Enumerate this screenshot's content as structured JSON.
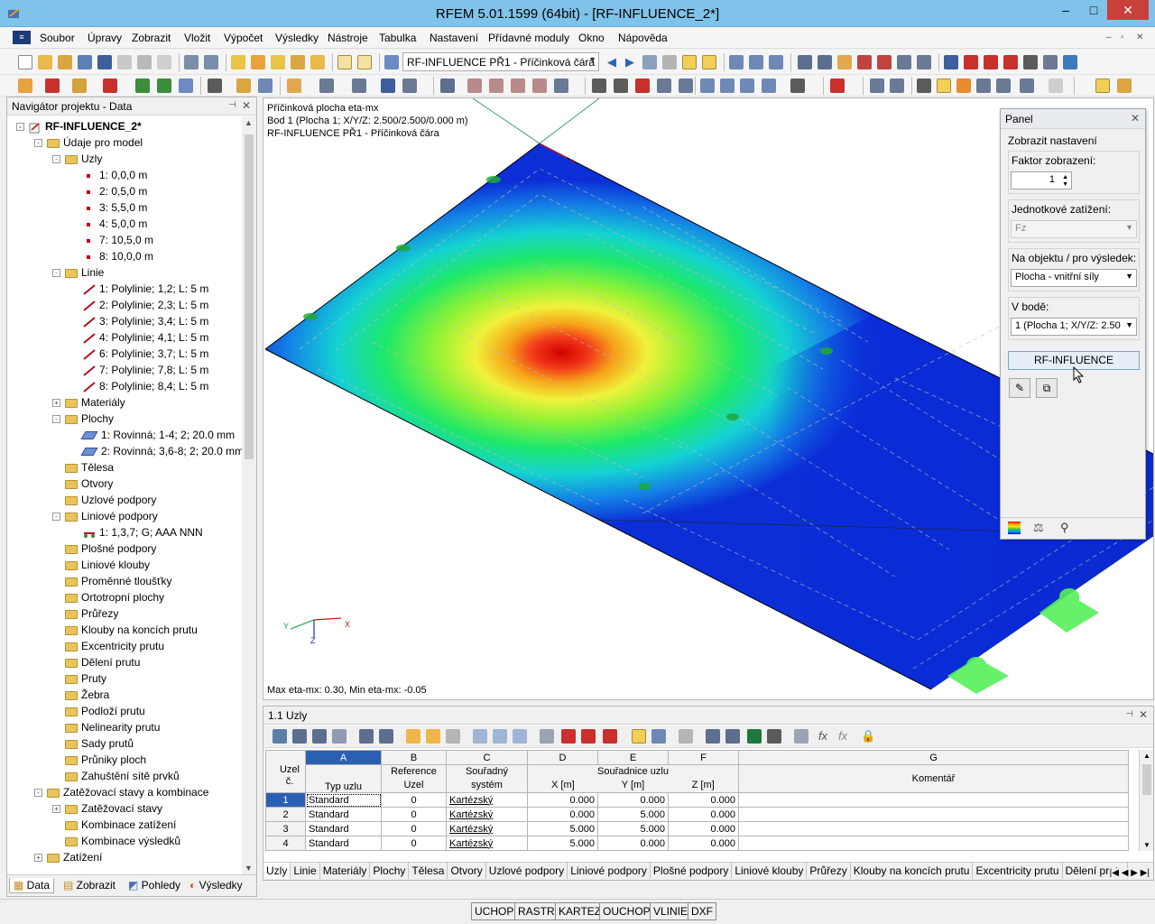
{
  "window": {
    "title": "RFEM 5.01.1599 (64bit) - [RF-INFLUENCE_2*]",
    "min": "–",
    "max": "□",
    "close": "✕"
  },
  "menu": [
    "Soubor",
    "Úpravy",
    "Zobrazit",
    "Vložit",
    "Výpočet",
    "Výsledky",
    "Nástroje",
    "Tabulka",
    "Nastavení",
    "Přídavné moduly",
    "Okno",
    "Nápověda"
  ],
  "toolbar": {
    "case_combo": "RF-INFLUENCE PŘ1 - Příčinková čára"
  },
  "navigator": {
    "title": "Navigátor projektu - Data",
    "root": "RF-INFLUENCE_2*",
    "items": [
      {
        "label": "Údaje pro model",
        "level": 1,
        "kind": "folder",
        "exp": "-"
      },
      {
        "label": "Uzly",
        "level": 2,
        "kind": "folder",
        "exp": "-"
      },
      {
        "label": "1: 0,0,0 m",
        "level": 3,
        "kind": "node"
      },
      {
        "label": "2: 0,5,0 m",
        "level": 3,
        "kind": "node"
      },
      {
        "label": "3: 5,5,0 m",
        "level": 3,
        "kind": "node"
      },
      {
        "label": "4: 5,0,0 m",
        "level": 3,
        "kind": "node"
      },
      {
        "label": "7: 10,5,0 m",
        "level": 3,
        "kind": "node"
      },
      {
        "label": "8: 10,0,0 m",
        "level": 3,
        "kind": "node"
      },
      {
        "label": "Linie",
        "level": 2,
        "kind": "folder",
        "exp": "-"
      },
      {
        "label": "1: Polylinie; 1,2; L: 5 m",
        "level": 3,
        "kind": "line"
      },
      {
        "label": "2: Polylinie; 2,3; L: 5 m",
        "level": 3,
        "kind": "line"
      },
      {
        "label": "3: Polylinie; 3,4; L: 5 m",
        "level": 3,
        "kind": "line"
      },
      {
        "label": "4: Polylinie; 4,1; L: 5 m",
        "level": 3,
        "kind": "line"
      },
      {
        "label": "6: Polylinie; 3,7; L: 5 m",
        "level": 3,
        "kind": "line"
      },
      {
        "label": "7: Polylinie; 7,8; L: 5 m",
        "level": 3,
        "kind": "line"
      },
      {
        "label": "8: Polylinie; 8,4; L: 5 m",
        "level": 3,
        "kind": "line"
      },
      {
        "label": "Materiály",
        "level": 2,
        "kind": "folder",
        "exp": "+"
      },
      {
        "label": "Plochy",
        "level": 2,
        "kind": "folder",
        "exp": "-"
      },
      {
        "label": "1: Rovinná; 1-4; 2; 20.0 mm",
        "level": 3,
        "kind": "plane"
      },
      {
        "label": "2: Rovinná; 3,6-8; 2; 20.0 mm",
        "level": 3,
        "kind": "plane"
      },
      {
        "label": "Tělesa",
        "level": 2,
        "kind": "folder"
      },
      {
        "label": "Otvory",
        "level": 2,
        "kind": "folder"
      },
      {
        "label": "Uzlové podpory",
        "level": 2,
        "kind": "folder"
      },
      {
        "label": "Liniové podpory",
        "level": 2,
        "kind": "folder",
        "exp": "-"
      },
      {
        "label": "1: 1,3,7; G; AAA NNN",
        "level": 3,
        "kind": "support"
      },
      {
        "label": "Plošné podpory",
        "level": 2,
        "kind": "folder"
      },
      {
        "label": "Liniové klouby",
        "level": 2,
        "kind": "folder"
      },
      {
        "label": "Proměnné tloušťky",
        "level": 2,
        "kind": "folder"
      },
      {
        "label": "Ortotropní plochy",
        "level": 2,
        "kind": "folder"
      },
      {
        "label": "Průřezy",
        "level": 2,
        "kind": "folder"
      },
      {
        "label": "Klouby na koncích prutu",
        "level": 2,
        "kind": "folder"
      },
      {
        "label": "Excentricity prutu",
        "level": 2,
        "kind": "folder"
      },
      {
        "label": "Dělení prutu",
        "level": 2,
        "kind": "folder"
      },
      {
        "label": "Pruty",
        "level": 2,
        "kind": "folder"
      },
      {
        "label": "Žebra",
        "level": 2,
        "kind": "folder"
      },
      {
        "label": "Podloží prutu",
        "level": 2,
        "kind": "folder"
      },
      {
        "label": "Nelinearity prutu",
        "level": 2,
        "kind": "folder"
      },
      {
        "label": "Sady prutů",
        "level": 2,
        "kind": "folder"
      },
      {
        "label": "Průniky ploch",
        "level": 2,
        "kind": "folder"
      },
      {
        "label": "Zahuštění sítě prvků",
        "level": 2,
        "kind": "folder"
      },
      {
        "label": "Zatěžovací stavy a kombinace",
        "level": 1,
        "kind": "folder",
        "exp": "-"
      },
      {
        "label": "Zatěžovací stavy",
        "level": 2,
        "kind": "folder",
        "exp": "+"
      },
      {
        "label": "Kombinace zatížení",
        "level": 2,
        "kind": "folder"
      },
      {
        "label": "Kombinace výsledků",
        "level": 2,
        "kind": "folder"
      },
      {
        "label": "Zatížení",
        "level": 1,
        "kind": "folder",
        "exp": "+"
      }
    ],
    "tabs": [
      "Data",
      "Zobrazit",
      "Pohledy",
      "Výsledky"
    ]
  },
  "viewport": {
    "line1": "Příčinková plocha eta-mx",
    "line2": "Bod 1 (Plocha 1; X/Y/Z: 2.500/2.500/0.000 m)",
    "line3": "RF-INFLUENCE PŘ1 - Příčinková čára",
    "footer": "Max eta-mx: 0.30, Min eta-mx: -0.05",
    "axes": {
      "x": "X",
      "y": "Y",
      "z": "Z"
    }
  },
  "panel": {
    "title": "Panel",
    "section": "Zobrazit nastavení",
    "factor_label": "Faktor zobrazení:",
    "factor_value": "1",
    "unit_load_label": "Jednotkové zatížení:",
    "unit_load_value": "Fz",
    "object_label": "Na objektu / pro výsledek:",
    "object_value": "Plocha - vnitřní síly",
    "point_label": "V bodě:",
    "point_value": "1 (Plocha 1; X/Y/Z: 2.50",
    "button": "RF-INFLUENCE"
  },
  "table": {
    "title": "1.1 Uzly",
    "col_letters": [
      "A",
      "B",
      "C",
      "D",
      "E",
      "F",
      "G"
    ],
    "head_uzel": "Uzel č.",
    "head_typ": "Typ uzlu",
    "head_ref": "Reference Uzel",
    "head_sys": "Souřadný systém",
    "head_coords": "Souřadnice uzlu",
    "head_x": "X [m]",
    "head_y": "Y [m]",
    "head_z": "Z [m]",
    "head_comment": "Komentář",
    "rows": [
      {
        "n": "1",
        "typ": "Standard",
        "ref": "0",
        "sys": "Kartézský",
        "x": "0.000",
        "y": "0.000",
        "z": "0.000"
      },
      {
        "n": "2",
        "typ": "Standard",
        "ref": "0",
        "sys": "Kartézský",
        "x": "0.000",
        "y": "5.000",
        "z": "0.000"
      },
      {
        "n": "3",
        "typ": "Standard",
        "ref": "0",
        "sys": "Kartézský",
        "x": "5.000",
        "y": "5.000",
        "z": "0.000"
      },
      {
        "n": "4",
        "typ": "Standard",
        "ref": "0",
        "sys": "Kartézský",
        "x": "5.000",
        "y": "0.000",
        "z": "0.000"
      }
    ],
    "tabs": [
      "Uzly",
      "Linie",
      "Materiály",
      "Plochy",
      "Tělesa",
      "Otvory",
      "Uzlové podpory",
      "Liniové podpory",
      "Plošné podpory",
      "Liniové klouby",
      "Průřezy",
      "Klouby na koncích prutu",
      "Excentricity prutu",
      "Dělení prutu"
    ]
  },
  "status": [
    "UCHOP",
    "RASTR",
    "KARTEZ",
    "OUCHOP",
    "VLINIE",
    "DXF"
  ]
}
